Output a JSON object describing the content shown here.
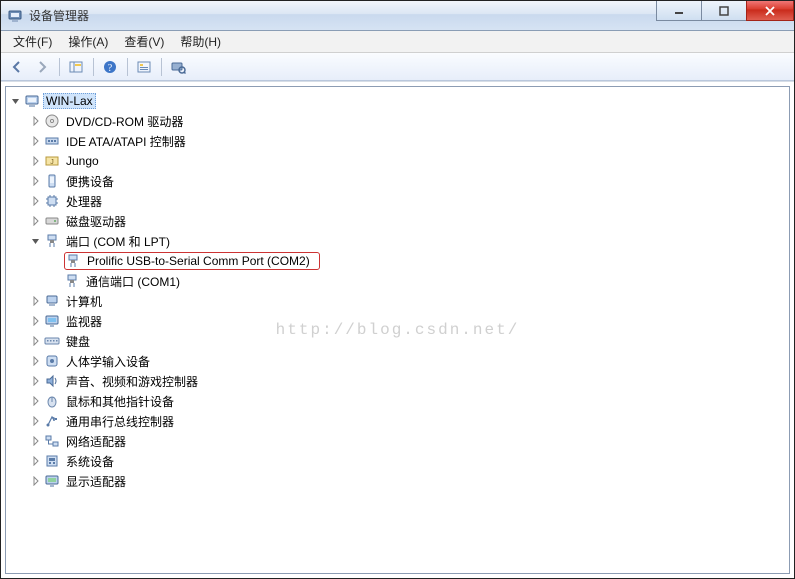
{
  "window": {
    "title": "设备管理器"
  },
  "menubar": {
    "file": "文件(F)",
    "action": "操作(A)",
    "view": "查看(V)",
    "help": "帮助(H)"
  },
  "watermark": "http://blog.csdn.net/",
  "tree": {
    "root": {
      "label": "WIN-Lax",
      "icon": "computer"
    },
    "items": [
      {
        "label": "DVD/CD-ROM 驱动器",
        "icon": "disc",
        "expandable": true
      },
      {
        "label": "IDE ATA/ATAPI 控制器",
        "icon": "controller",
        "expandable": true
      },
      {
        "label": "Jungo",
        "icon": "jungo",
        "expandable": true
      },
      {
        "label": "便携设备",
        "icon": "portable",
        "expandable": true
      },
      {
        "label": "处理器",
        "icon": "cpu",
        "expandable": true
      },
      {
        "label": "磁盘驱动器",
        "icon": "disk",
        "expandable": true
      },
      {
        "label": "端口 (COM 和 LPT)",
        "icon": "port",
        "expandable": true,
        "expanded": true,
        "children": [
          {
            "label": "Prolific USB-to-Serial Comm Port (COM2)",
            "icon": "port",
            "highlight": true
          },
          {
            "label": "通信端口 (COM1)",
            "icon": "port"
          }
        ]
      },
      {
        "label": "计算机",
        "icon": "computer-small",
        "expandable": true
      },
      {
        "label": "监视器",
        "icon": "monitor",
        "expandable": true
      },
      {
        "label": "键盘",
        "icon": "keyboard",
        "expandable": true
      },
      {
        "label": "人体学输入设备",
        "icon": "hid",
        "expandable": true
      },
      {
        "label": "声音、视频和游戏控制器",
        "icon": "sound",
        "expandable": true
      },
      {
        "label": "鼠标和其他指针设备",
        "icon": "mouse",
        "expandable": true
      },
      {
        "label": "通用串行总线控制器",
        "icon": "usb",
        "expandable": true
      },
      {
        "label": "网络适配器",
        "icon": "network",
        "expandable": true
      },
      {
        "label": "系统设备",
        "icon": "system",
        "expandable": true
      },
      {
        "label": "显示适配器",
        "icon": "display",
        "expandable": true
      }
    ]
  }
}
